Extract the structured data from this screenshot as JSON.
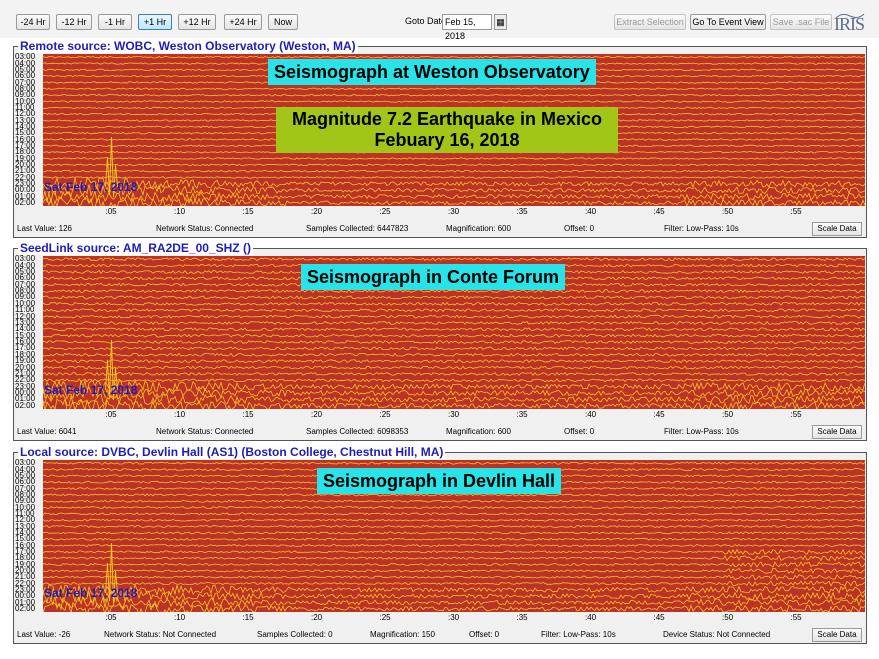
{
  "toolbar": {
    "buttons": [
      "-24 Hr",
      "-12 Hr",
      "-1 Hr",
      "+1 Hr",
      "+12 Hr",
      "+24 Hr",
      "Now"
    ],
    "goto_label": "Goto Date:",
    "goto_value": "Feb 15, 2018",
    "extract_label": "Extract Selection",
    "event_view_label": "Go To Event View",
    "save_sac_label": "Save .sac File",
    "logo_text": "IRIS"
  },
  "hour_labels": [
    "03:00",
    "04:00",
    "05:00",
    "06:00",
    "07:00",
    "08:00",
    "09:00",
    "10:00",
    "11:00",
    "12:00",
    "13:00",
    "14:00",
    "15:00",
    "16:00",
    "17:00",
    "18:00",
    "19:00",
    "20:00",
    "21:00",
    "22:00",
    "23:00",
    "00:00",
    "01:00",
    "02:00"
  ],
  "minute_labels": [
    ":05",
    ":10",
    ":15",
    ":20",
    ":25",
    ":30",
    ":35",
    ":40",
    ":45",
    ":50",
    ":55"
  ],
  "colors": {
    "plot_bg": "#bb3328",
    "trace": "#f6c31e",
    "grid": "#d96b2b",
    "title_blue": "#1d1dba",
    "banner_cyan": "#28e4e8",
    "banner_green": "#a1c617"
  },
  "panels": [
    {
      "title": "Remote source: WOBC, Weston Observatory (Weston, MA)",
      "date_overlay": "Sat Feb 17, 2018",
      "banner": "Seismograph at Weston Observatory",
      "event_banner_line1": "Magnitude 7.2 Earthquake in Mexico",
      "event_banner_line2": "Febuary 16, 2018",
      "last_value": "Last Value:  126",
      "network_status": "Network Status:  Connected",
      "samples": "Samples Collected:  6447823",
      "magnification": "Magnification:  600",
      "offset": "Offset:  0",
      "filter": "Filter:  Low-Pass: 10s",
      "device_status": "",
      "scale_label": "Scale Data"
    },
    {
      "title": "SeedLink source: AM_RA2DE_00_SHZ ()",
      "date_overlay": "Sat Feb 17, 2018",
      "banner": "Seismograph in Conte Forum",
      "last_value": "Last Value:  6041",
      "network_status": "Network Status:  Connected",
      "samples": "Samples Collected:  6098353",
      "magnification": "Magnification:  600",
      "offset": "Offset:  0",
      "filter": "Filter:  Low-Pass: 10s",
      "device_status": "",
      "scale_label": "Scale Data"
    },
    {
      "title": "Local source: DVBC, Devlin Hall (AS1) (Boston College, Chestnut Hill, MA)",
      "date_overlay": "Sat Feb 17, 2018",
      "banner": "Seismograph in Devlin Hall",
      "last_value": "Last Value:  -26",
      "network_status": "Network Status:  Not Connected",
      "samples": "Samples Collected:  0",
      "magnification": "Magnification:  150",
      "offset": "Offset:  0",
      "filter": "Filter:  Low-Pass: 10s",
      "device_status": "Device Status:  Not Connected",
      "scale_label": "Scale Data"
    }
  ]
}
